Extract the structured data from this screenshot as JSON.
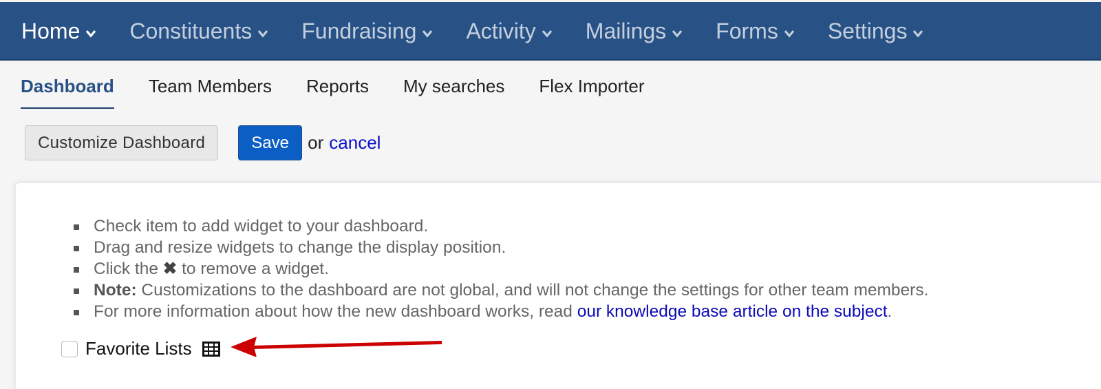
{
  "top_nav": {
    "items": [
      {
        "label": "Home",
        "active": true
      },
      {
        "label": "Constituents",
        "active": false
      },
      {
        "label": "Fundraising",
        "active": false
      },
      {
        "label": "Activity",
        "active": false
      },
      {
        "label": "Mailings",
        "active": false
      },
      {
        "label": "Forms",
        "active": false
      },
      {
        "label": "Settings",
        "active": false
      }
    ],
    "chevron_icon": "chevron-down-icon",
    "background_color": "#285185"
  },
  "sub_nav": {
    "items": [
      {
        "label": "Dashboard",
        "active": true
      },
      {
        "label": "Team Members",
        "active": false
      },
      {
        "label": "Reports",
        "active": false
      },
      {
        "label": "My searches",
        "active": false
      },
      {
        "label": "Flex Importer",
        "active": false
      }
    ]
  },
  "actions": {
    "customize_label": "Customize Dashboard",
    "save_label": "Save",
    "or_text": "or",
    "cancel_label": "cancel",
    "save_color": "#0b5ec4"
  },
  "instructions": {
    "items": [
      {
        "text": "Check item to add widget to your dashboard."
      },
      {
        "text": "Drag and resize widgets to change the display position."
      },
      {
        "prefix": "Click the",
        "glyph": "✖",
        "suffix": "to remove a widget."
      },
      {
        "bold": "Note:",
        "text": "Customizations to the dashboard are not global, and will not change the settings for other team members."
      },
      {
        "text": "For more information about how the new dashboard works, read",
        "link": "our knowledge base article on the subject",
        "after": "."
      }
    ]
  },
  "widgets": [
    {
      "label": "Favorite Lists",
      "checked": false,
      "icon": "table-grid-icon"
    }
  ],
  "annotation": {
    "type": "arrow",
    "color": "#cc0000",
    "points_to": "Favorite Lists table icon"
  }
}
